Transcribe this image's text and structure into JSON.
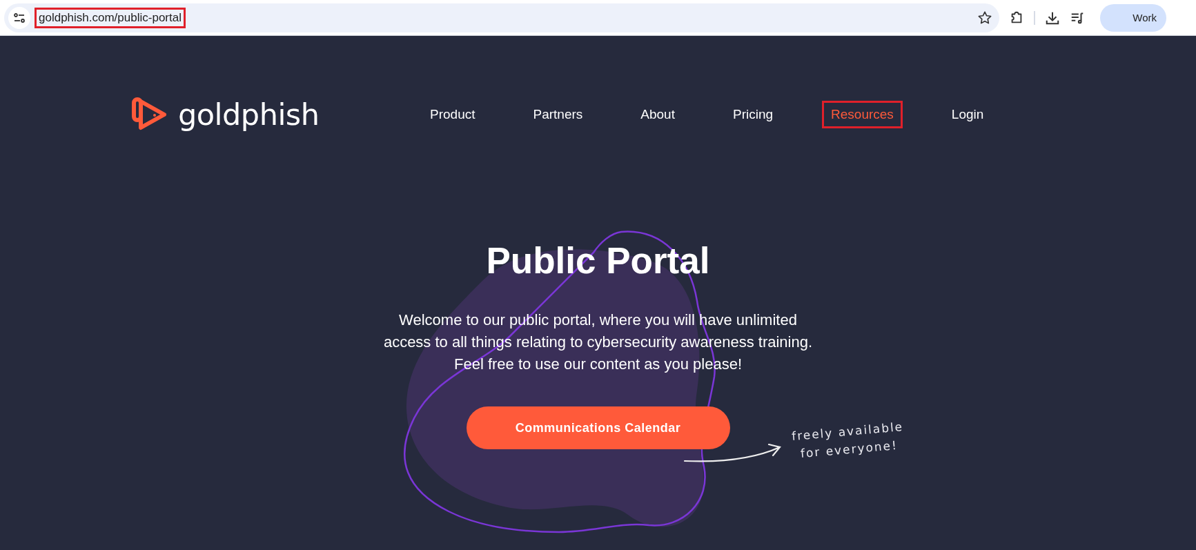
{
  "browser": {
    "url": "goldphish.com/public-portal",
    "url_highlighted": true,
    "profile": "Work"
  },
  "logo": {
    "text": "goldphish"
  },
  "nav": [
    {
      "label": "Product",
      "highlighted": false
    },
    {
      "label": "Partners",
      "highlighted": false
    },
    {
      "label": "About",
      "highlighted": false
    },
    {
      "label": "Pricing",
      "highlighted": false
    },
    {
      "label": "Resources",
      "highlighted": true
    },
    {
      "label": "Login",
      "highlighted": false
    }
  ],
  "hero": {
    "title": "Public Portal",
    "intro_lines": [
      "Welcome to our public portal, where you will have unlimited",
      "access to all things relating to cybersecurity awareness training.",
      "Feel free to use our content as you please!"
    ],
    "button": "Communications Calendar",
    "note_lines": [
      "freely available",
      "for everyone!"
    ]
  }
}
